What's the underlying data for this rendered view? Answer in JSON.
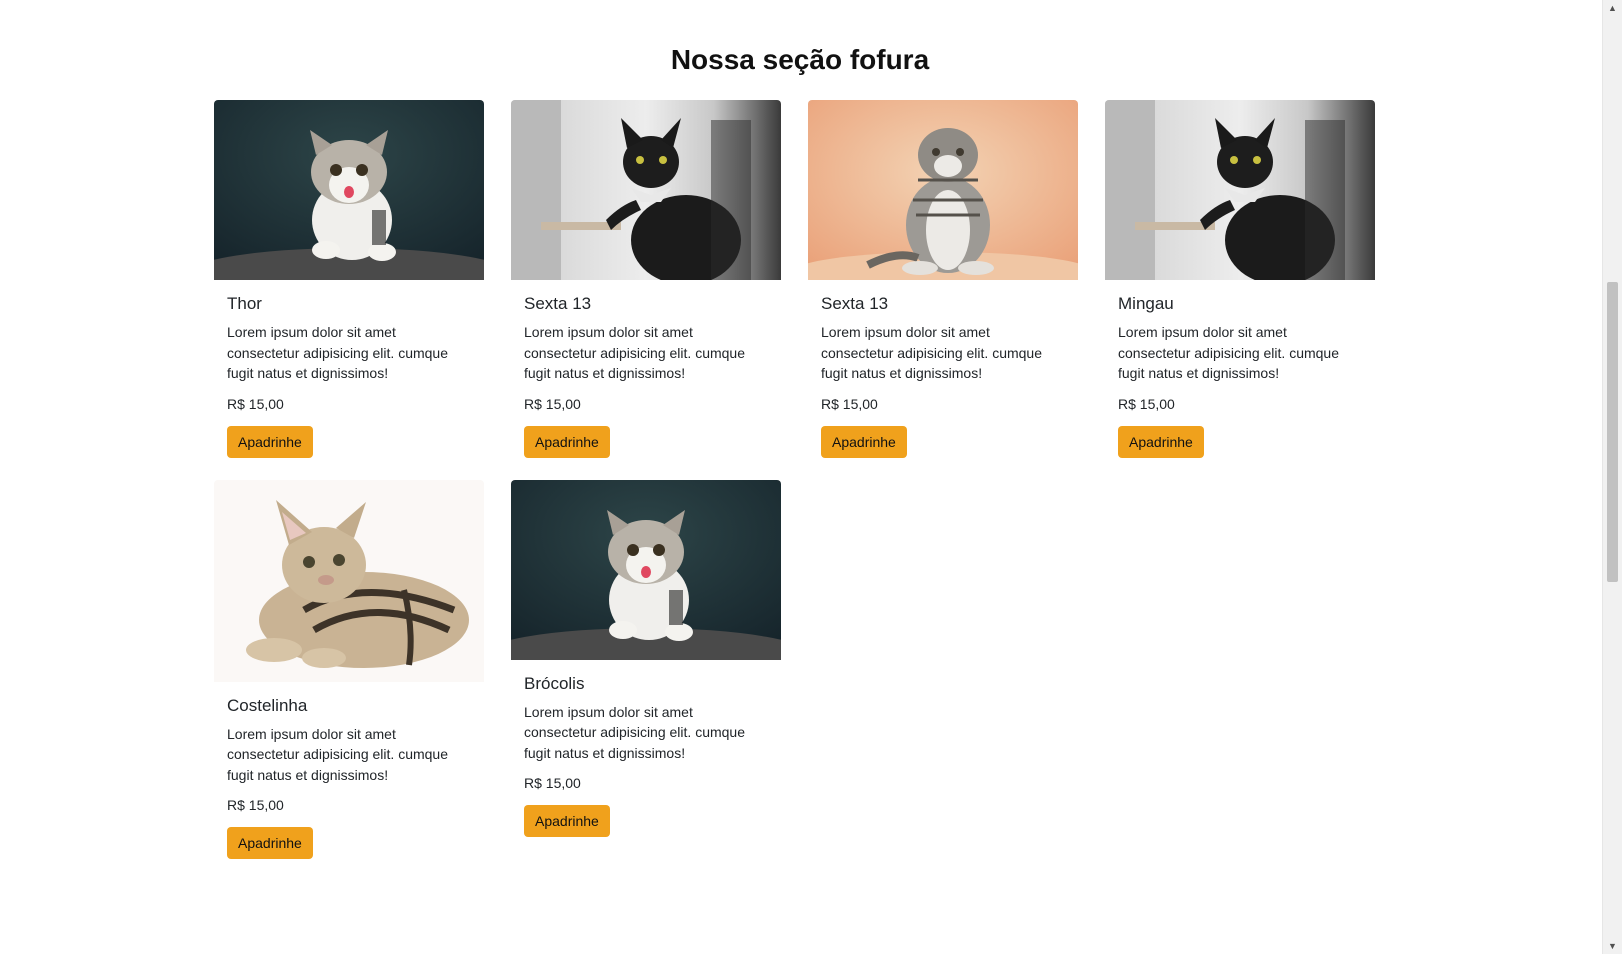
{
  "section": {
    "title": "Nossa seção fofura"
  },
  "colors": {
    "button": "#f0a11c",
    "text": "#212529",
    "background": "#ffffff"
  },
  "cards": [
    {
      "image": "kitten-tongue-dark-bg",
      "title": "Thor",
      "text": "Lorem ipsum dolor sit amet consectetur adipisicing elit. cumque fugit natus et dignissimos!",
      "price": "R$ 15,00",
      "button": "Apadrinhe"
    },
    {
      "image": "black-cat-bowtie",
      "title": "Sexta 13",
      "text": "Lorem ipsum dolor sit amet consectetur adipisicing elit. cumque fugit natus et dignissimos!",
      "price": "R$ 15,00",
      "button": "Apadrinhe"
    },
    {
      "image": "tabby-fold-sitting",
      "title": "Sexta 13",
      "text": "Lorem ipsum dolor sit amet consectetur adipisicing elit. cumque fugit natus et dignissimos!",
      "price": "R$ 15,00",
      "button": "Apadrinhe"
    },
    {
      "image": "black-cat-bowtie",
      "title": "Mingau",
      "text": "Lorem ipsum dolor sit amet consectetur adipisicing elit. cumque fugit natus et dignissimos!",
      "price": "R$ 15,00",
      "button": "Apadrinhe"
    },
    {
      "image": "tabby-kitten-lying",
      "title": "Costelinha",
      "text": "Lorem ipsum dolor sit amet consectetur adipisicing elit. cumque fugit natus et dignissimos!",
      "price": "R$ 15,00",
      "button": "Apadrinhe"
    },
    {
      "image": "kitten-tongue-dark-bg",
      "title": "Brócolis",
      "text": "Lorem ipsum dolor sit amet consectetur adipisicing elit. cumque fugit natus et dignissimos!",
      "price": "R$ 15,00",
      "button": "Apadrinhe"
    }
  ]
}
